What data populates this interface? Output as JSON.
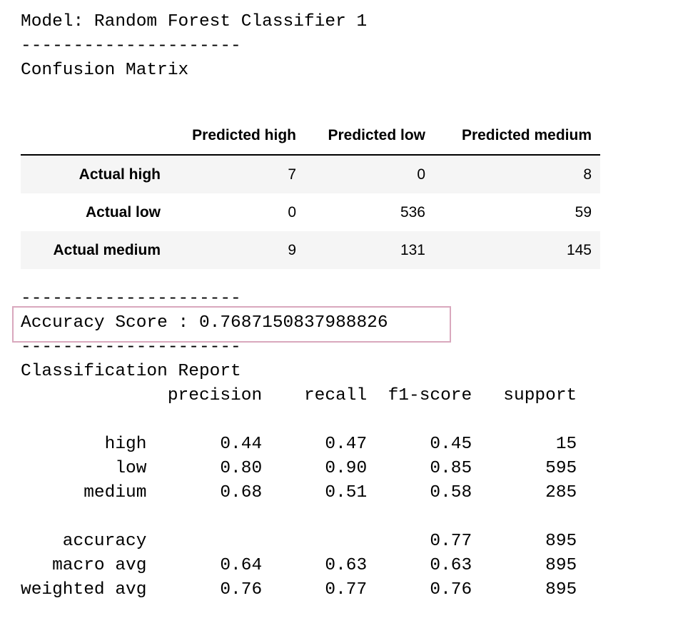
{
  "header": {
    "model_line": "Model: Random Forest Classifier 1",
    "separator": "---------------------",
    "cm_title": "Confusion Matrix"
  },
  "confusion_matrix": {
    "columns": [
      "Predicted high",
      "Predicted low",
      "Predicted medium"
    ],
    "rows": [
      {
        "label": "Actual high",
        "values": [
          "7",
          "0",
          "8"
        ]
      },
      {
        "label": "Actual low",
        "values": [
          "0",
          "536",
          "59"
        ]
      },
      {
        "label": "Actual medium",
        "values": [
          "9",
          "131",
          "145"
        ]
      }
    ]
  },
  "accuracy": {
    "separator_top": "---------------------",
    "line": "Accuracy Score : 0.7687150837988826",
    "separator_bottom": "---------------------",
    "highlight_color": "#d9a8bd"
  },
  "report": {
    "title": "Classification Report",
    "lines": [
      "              precision    recall  f1-score   support",
      "",
      "        high       0.44      0.47      0.45        15",
      "         low       0.80      0.90      0.85       595",
      "      medium       0.68      0.51      0.58       285",
      "",
      "    accuracy                           0.77       895",
      "   macro avg       0.64      0.63      0.63       895",
      "weighted avg       0.76      0.77      0.76       895"
    ]
  }
}
